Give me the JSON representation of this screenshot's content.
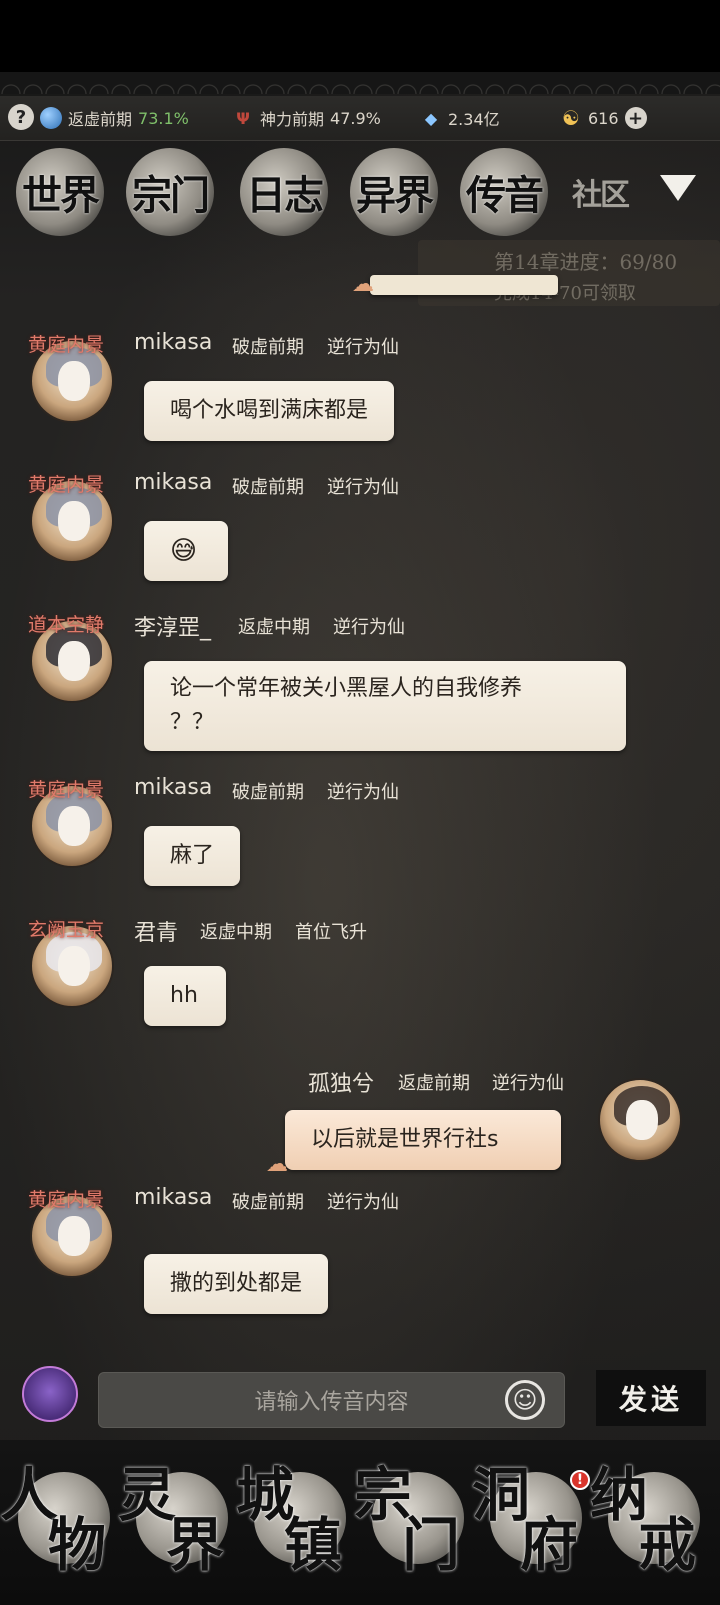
{
  "resources": {
    "help": "?",
    "realm1_label": "返虚前期",
    "realm1_pct": "73.1%",
    "realm2_label": "神力前期",
    "realm2_pct": "47.9%",
    "crystals": "2.34亿",
    "coins": "616",
    "add": "+"
  },
  "tabs": [
    "世界",
    "宗门",
    "日志",
    "异界",
    "传音",
    "社区"
  ],
  "chapter": {
    "title": "第14章进度：69/80",
    "subtitle": "完成14-70可领取"
  },
  "messages": [
    {
      "rank": "黄庭内景",
      "name": "mikasa",
      "realm": "破虚前期",
      "title": "逆行为仙",
      "text": "喝个水喝到满床都是"
    },
    {
      "rank": "黄庭内景",
      "name": "mikasa",
      "realm": "破虚前期",
      "title": "逆行为仙",
      "text": "😅"
    },
    {
      "rank": "道本空静",
      "name": "李淳罡_",
      "realm": "返虚中期",
      "title": "逆行为仙",
      "text": "论一个常年被关小黑屋人的自我修养",
      "text2": "？？"
    },
    {
      "rank": "黄庭内景",
      "name": "mikasa",
      "realm": "破虚前期",
      "title": "逆行为仙",
      "text": "麻了"
    },
    {
      "rank": "玄阙玉京",
      "name": "君青",
      "realm": "返虚中期",
      "title": "首位飞升",
      "text": "hh"
    },
    {
      "self": true,
      "name": "孤独兮",
      "realm": "返虚前期",
      "title": "逆行为仙",
      "text": "以后就是世界行社s"
    },
    {
      "rank": "黄庭内景",
      "name": "mikasa",
      "realm": "破虚前期",
      "title": "逆行为仙",
      "text": "撒的到处都是"
    }
  ],
  "input": {
    "placeholder": "请输入传音内容",
    "send": "发送"
  },
  "nav": [
    {
      "c1": "人",
      "c2": "物"
    },
    {
      "c1": "灵",
      "c2": "界"
    },
    {
      "c1": "城",
      "c2": "镇"
    },
    {
      "c1": "宗",
      "c2": "门"
    },
    {
      "c1": "洞",
      "c2": "府"
    },
    {
      "c1": "纳",
      "c2": "戒"
    }
  ],
  "badge": "!"
}
